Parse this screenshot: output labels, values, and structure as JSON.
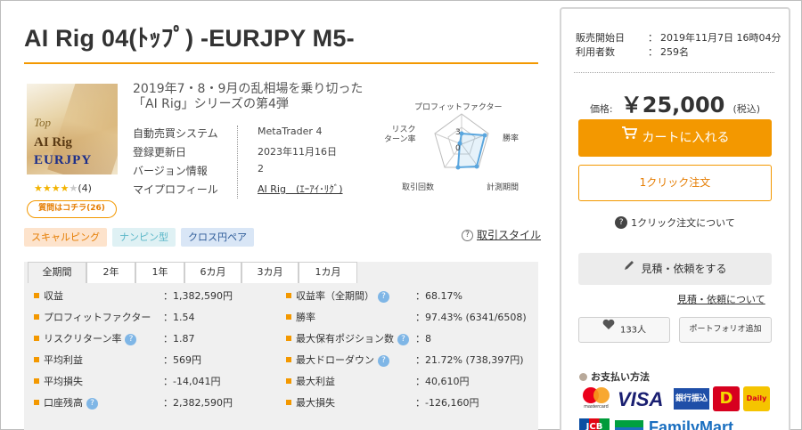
{
  "title": "AI Rig 04(ﾄｯﾌﾟ) -EURJPY M5-",
  "thumbnail": {
    "line1": "Top",
    "line2": "AI Rig",
    "line3": "EURJPY"
  },
  "rating": {
    "stars_filled": 4,
    "stars_total": 5,
    "count": "(4)",
    "star_glyphs": "★★★★",
    "empty_glyph": "★"
  },
  "qa_button": "質問はコチラ(26)",
  "description": "2019年7・8・9月の乱相場を乗り切った「AI Rig」シリーズの第4弾",
  "info": [
    {
      "label": "自動売買システム",
      "value": "MetaTrader 4"
    },
    {
      "label": "登録更新日",
      "value": "2023年11月16日"
    },
    {
      "label": "バージョン情報",
      "value": "2"
    },
    {
      "label": "マイプロフィール",
      "value": "AI Rig　(ｴｰｱｲ･ﾘｸﾞ)"
    }
  ],
  "radar": {
    "labels": {
      "top": "プロフィットファクター",
      "right": "勝率",
      "bottom_right": "計測期間",
      "bottom_left": "取引回数",
      "left": "リスク\nターン率"
    },
    "scale_labels": [
      "3",
      "0"
    ],
    "color": "#5aa6de"
  },
  "tags": [
    "スキャルピング",
    "ナンピン型",
    "クロス円ペア"
  ],
  "trade_style": {
    "icon": "?",
    "label": "取引スタイル"
  },
  "tabs": [
    "全期間",
    "2年",
    "1年",
    "6カ月",
    "3カ月",
    "1カ月"
  ],
  "stats_left": [
    {
      "label": "収益",
      "value": "：1,382,590円",
      "help": false
    },
    {
      "label": "プロフィットファクター",
      "value": "：1.54",
      "help": false
    },
    {
      "label": "リスクリターン率",
      "value": "：1.87",
      "help": true
    },
    {
      "label": "平均利益",
      "value": "：569円",
      "help": false
    },
    {
      "label": "平均損失",
      "value": "：-14,041円",
      "help": false
    },
    {
      "label": "口座残高",
      "value": "：2,382,590円",
      "help": true
    }
  ],
  "stats_right": [
    {
      "label": "収益率（全期間）",
      "value": "：68.17%",
      "help": true
    },
    {
      "label": "勝率",
      "value": "：97.43% (6341/6508)",
      "help": false
    },
    {
      "label": "最大保有ポジション数",
      "value": "：8",
      "help": true
    },
    {
      "label": "最大ドローダウン",
      "value": "：21.72% (738,397円)",
      "help": true
    },
    {
      "label": "最大利益",
      "value": "：40,610円",
      "help": false
    },
    {
      "label": "最大損失",
      "value": "：-126,160円",
      "help": false
    }
  ],
  "help_glyph": "?",
  "sidebar": {
    "meta": [
      {
        "label": "販売開始日",
        "value": "2019年11月7日 16時04分"
      },
      {
        "label": "利用者数",
        "value": "259名"
      }
    ],
    "colon": "：",
    "price_label": "価格:",
    "price": "￥25,000",
    "tax": "(税込)",
    "cart_button": "カートに入れる",
    "oneclick_button": "1クリック注文",
    "oneclick_about": "1クリック注文について",
    "quote_button": "見積・依頼をする",
    "quote_link": "見積・依頼について",
    "favorite_count": "133人",
    "portfolio_button": "ポートフォリオ追加",
    "payment_heading": "お支払い方法",
    "payment_logos": [
      "mastercard",
      "VISA",
      "銀行振込",
      "D",
      "Daily",
      "JCB",
      "FamilyMart"
    ],
    "accent_color": "#f39800"
  }
}
